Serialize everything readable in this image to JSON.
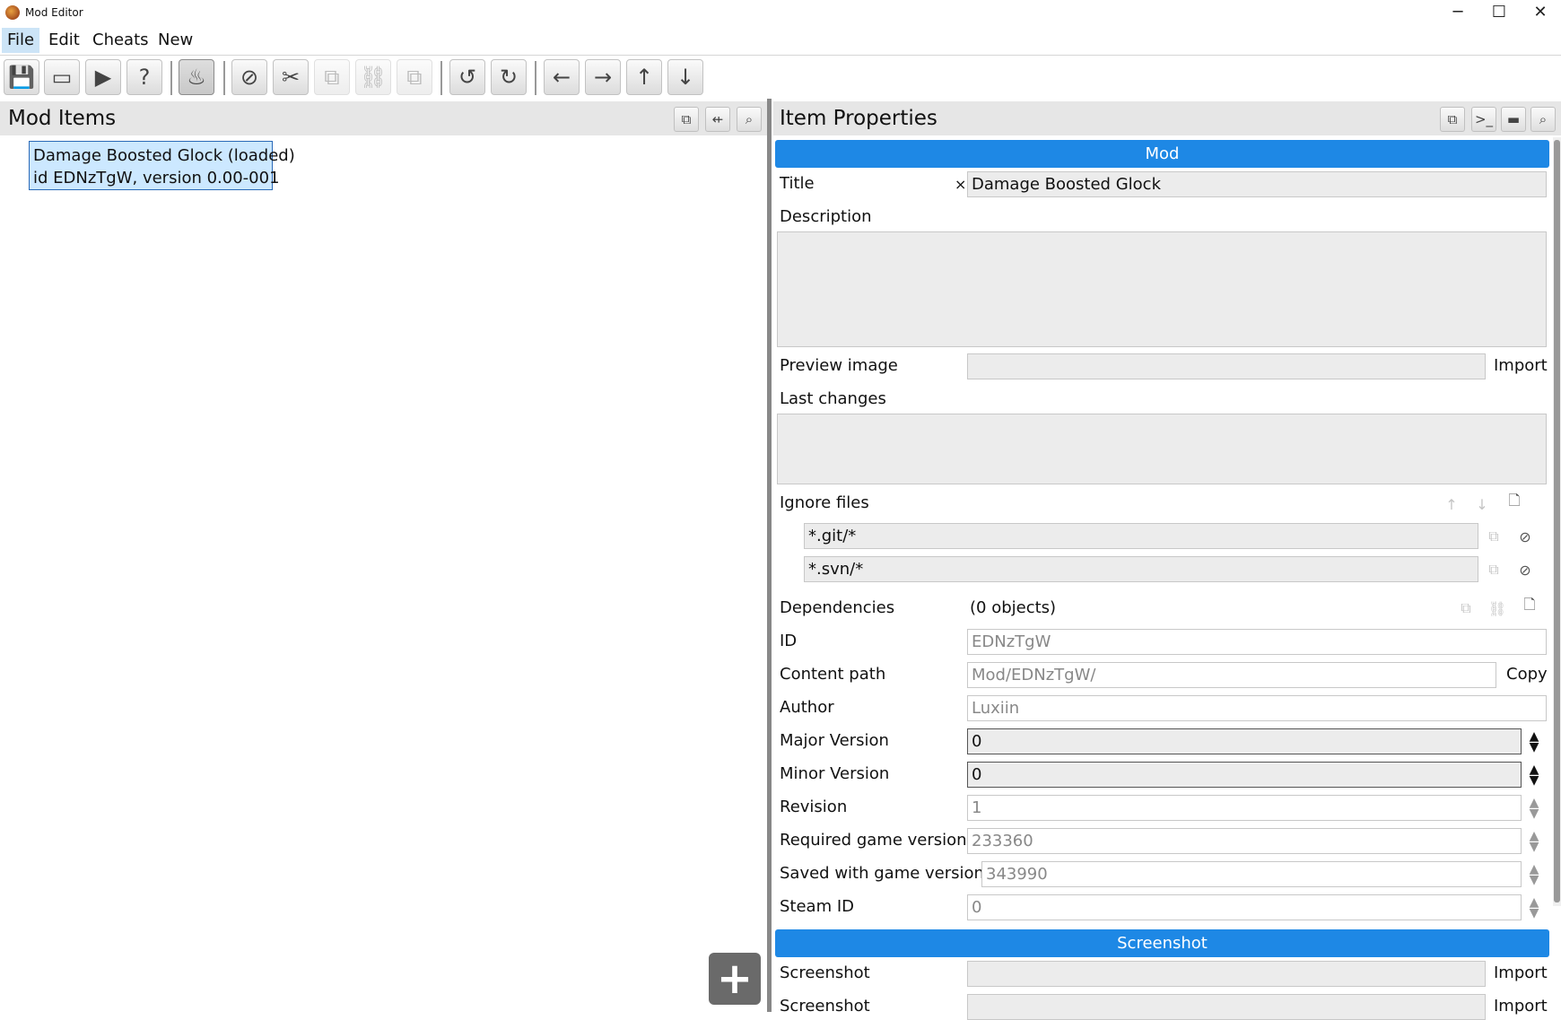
{
  "window": {
    "title": "Mod Editor",
    "minimize": "─",
    "maximize": "☐",
    "close": "✕"
  },
  "menu": [
    "File",
    "Edit",
    "Cheats",
    "New"
  ],
  "toolbar": {
    "save": "💾",
    "window": "▭",
    "play": "▶",
    "help": "?",
    "steam": "♨",
    "cancel": "⊘",
    "cut": "✂",
    "copy": "⧉",
    "link": "⛓",
    "paste": "⧉",
    "undo": "↺",
    "redo": "↻",
    "back": "←",
    "forward": "→",
    "up": "↑",
    "down": "↓"
  },
  "left_panel": {
    "title": "Mod Items",
    "item_line1": "Damage Boosted Glock (loaded)",
    "item_line2": "id EDNzTgW, version 0.00-001",
    "add": "+"
  },
  "right_panel": {
    "title": "Item Properties",
    "section_mod": "Mod",
    "title_label": "Title",
    "title_clear": "×",
    "title_value": "Damage Boosted Glock",
    "description_label": "Description",
    "preview_label": "Preview image",
    "import": "Import",
    "last_changes_label": "Last changes",
    "ignore_label": "Ignore files",
    "ignore_files": [
      "*.git/*",
      "*.svn/*"
    ],
    "dependencies_label": "Dependencies",
    "dependencies_value": "(0 objects)",
    "id_label": "ID",
    "id_value": "EDNzTgW",
    "content_path_label": "Content path",
    "content_path_value": "Mod/EDNzTgW/",
    "copy": "Copy",
    "author_label": "Author",
    "author_value": "Luxiin",
    "major_label": "Major Version",
    "major_value": "0",
    "minor_label": "Minor Version",
    "minor_value": "0",
    "revision_label": "Revision",
    "revision_value": "1",
    "req_game_label": "Required game version",
    "req_game_value": "233360",
    "saved_game_label": "Saved with game version",
    "saved_game_value": "343990",
    "steam_label": "Steam ID",
    "steam_value": "0",
    "section_screenshot": "Screenshot",
    "screenshot_label": "Screenshot"
  }
}
